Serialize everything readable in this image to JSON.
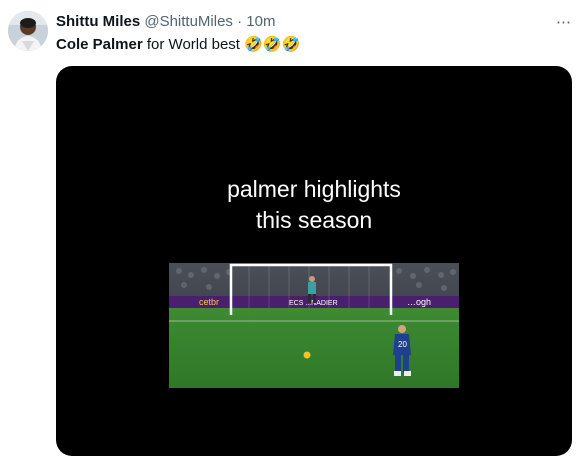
{
  "tweet": {
    "author_name": "Shittu Miles",
    "handle": "@ShittuMiles",
    "separator": "·",
    "time": "10m",
    "text_bold": "Cole Palmer",
    "text_rest": " for World best ",
    "emojis": "🤣🤣🤣",
    "more_icon": "⋯"
  },
  "media": {
    "caption_line1": "palmer highlights",
    "caption_line2": "this season",
    "ad_board_left": "cetbr",
    "ad_board_mid": "ECS ...NADIER",
    "ad_board_right": "…ogh",
    "player_number": "20"
  },
  "colors": {
    "text": "#0f1419",
    "secondary": "#536471",
    "media_bg": "#000000",
    "pitch": "#3f8a34",
    "board": "#4a1f6e"
  }
}
